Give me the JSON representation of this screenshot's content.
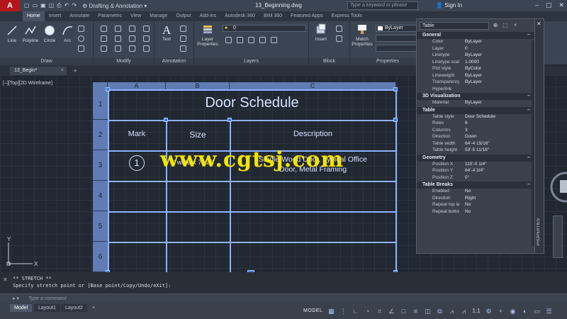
{
  "titlebar": {
    "app_logo": "A",
    "workspace": "Drafting & Annotation",
    "doc_title": "13_Beginning.dwg",
    "search_placeholder": "Type a keyword or phrase",
    "signin": "Sign In"
  },
  "ribbon_tabs": [
    "Home",
    "Insert",
    "Annotate",
    "Parametric",
    "View",
    "Manage",
    "Output",
    "Add-ins",
    "Autodesk 360",
    "BIM 360",
    "Featured Apps",
    "Express Tools"
  ],
  "ribbon": {
    "groups": {
      "draw": "Draw",
      "modify": "Modify",
      "annotation": "Annotation",
      "layers": "Layers",
      "block": "Block",
      "properties": "Properties"
    },
    "buttons": {
      "line": "Line",
      "polyline": "Polyline",
      "circle": "Circle",
      "arc": "Arc",
      "text": "Text",
      "layer_properties": "Layer Properties",
      "insert": "Insert",
      "match_properties": "Match Properties",
      "bylayer": "ByLayer",
      "layer_value": "0"
    }
  },
  "filetabs": {
    "active": "13_Begin*",
    "close": "×",
    "new": "+"
  },
  "viewport_label": "[–][Top][2D Wireframe]",
  "ucs": {
    "y": "Y",
    "x": "X"
  },
  "table": {
    "columns": [
      "A",
      "B",
      "C"
    ],
    "rows": [
      "1",
      "2",
      "3",
      "4",
      "5",
      "6"
    ],
    "title": "Door Schedule",
    "headers": [
      "Mark",
      "Size",
      "Description"
    ],
    "row3": {
      "mark": "1",
      "size": "3' wide x 7' tall",
      "description_line1": "Single Wood Door, Typical Office",
      "description_line2": "Door, Metal Framing"
    }
  },
  "watermark": "www.cgtsj.com",
  "properties": {
    "selector": "Table",
    "side_label": "PROPERTIES",
    "sections": [
      {
        "name": "General",
        "rows": [
          [
            "Color",
            "ByLayer"
          ],
          [
            "Layer",
            "0"
          ],
          [
            "Linetype",
            "ByLayer"
          ],
          [
            "Linetype scale",
            "1.0000"
          ],
          [
            "Plot style",
            "ByColor"
          ],
          [
            "Lineweight",
            "ByLayer"
          ],
          [
            "Transparency",
            "ByLayer"
          ],
          [
            "Hyperlink",
            ""
          ]
        ]
      },
      {
        "name": "3D Visualization",
        "rows": [
          [
            "Material",
            "ByLayer"
          ]
        ]
      },
      {
        "name": "Table",
        "rows": [
          [
            "Table style",
            "Door Schedule"
          ],
          [
            "Rows",
            "6"
          ],
          [
            "Columns",
            "3"
          ],
          [
            "Direction",
            "Down"
          ],
          [
            "Table width",
            "64'-4 15/16\""
          ],
          [
            "Table height",
            "53'-5 11/16\""
          ]
        ]
      },
      {
        "name": "Geometry",
        "rows": [
          [
            "Position X",
            "115'-0 1/4\""
          ],
          [
            "Position Y",
            "64'-4 3/4\""
          ],
          [
            "Position Z",
            "0\""
          ]
        ]
      },
      {
        "name": "Table Breaks",
        "rows": [
          [
            "Enabled",
            "No"
          ],
          [
            "Direction",
            "Right"
          ],
          [
            "Repeat top labels",
            "No"
          ],
          [
            "Repeat bottom labels",
            "No"
          ]
        ]
      }
    ]
  },
  "command": {
    "history_line1": "** STRETCH **",
    "history_line2": "Specify stretch point or [Base point/Copy/Undo/eXit]:",
    "input_placeholder": "Type a command"
  },
  "statusbar": {
    "tabs": [
      "Model",
      "Layout1",
      "Layout2"
    ],
    "add": "+",
    "mode": "MODEL",
    "scale": "1:1"
  }
}
